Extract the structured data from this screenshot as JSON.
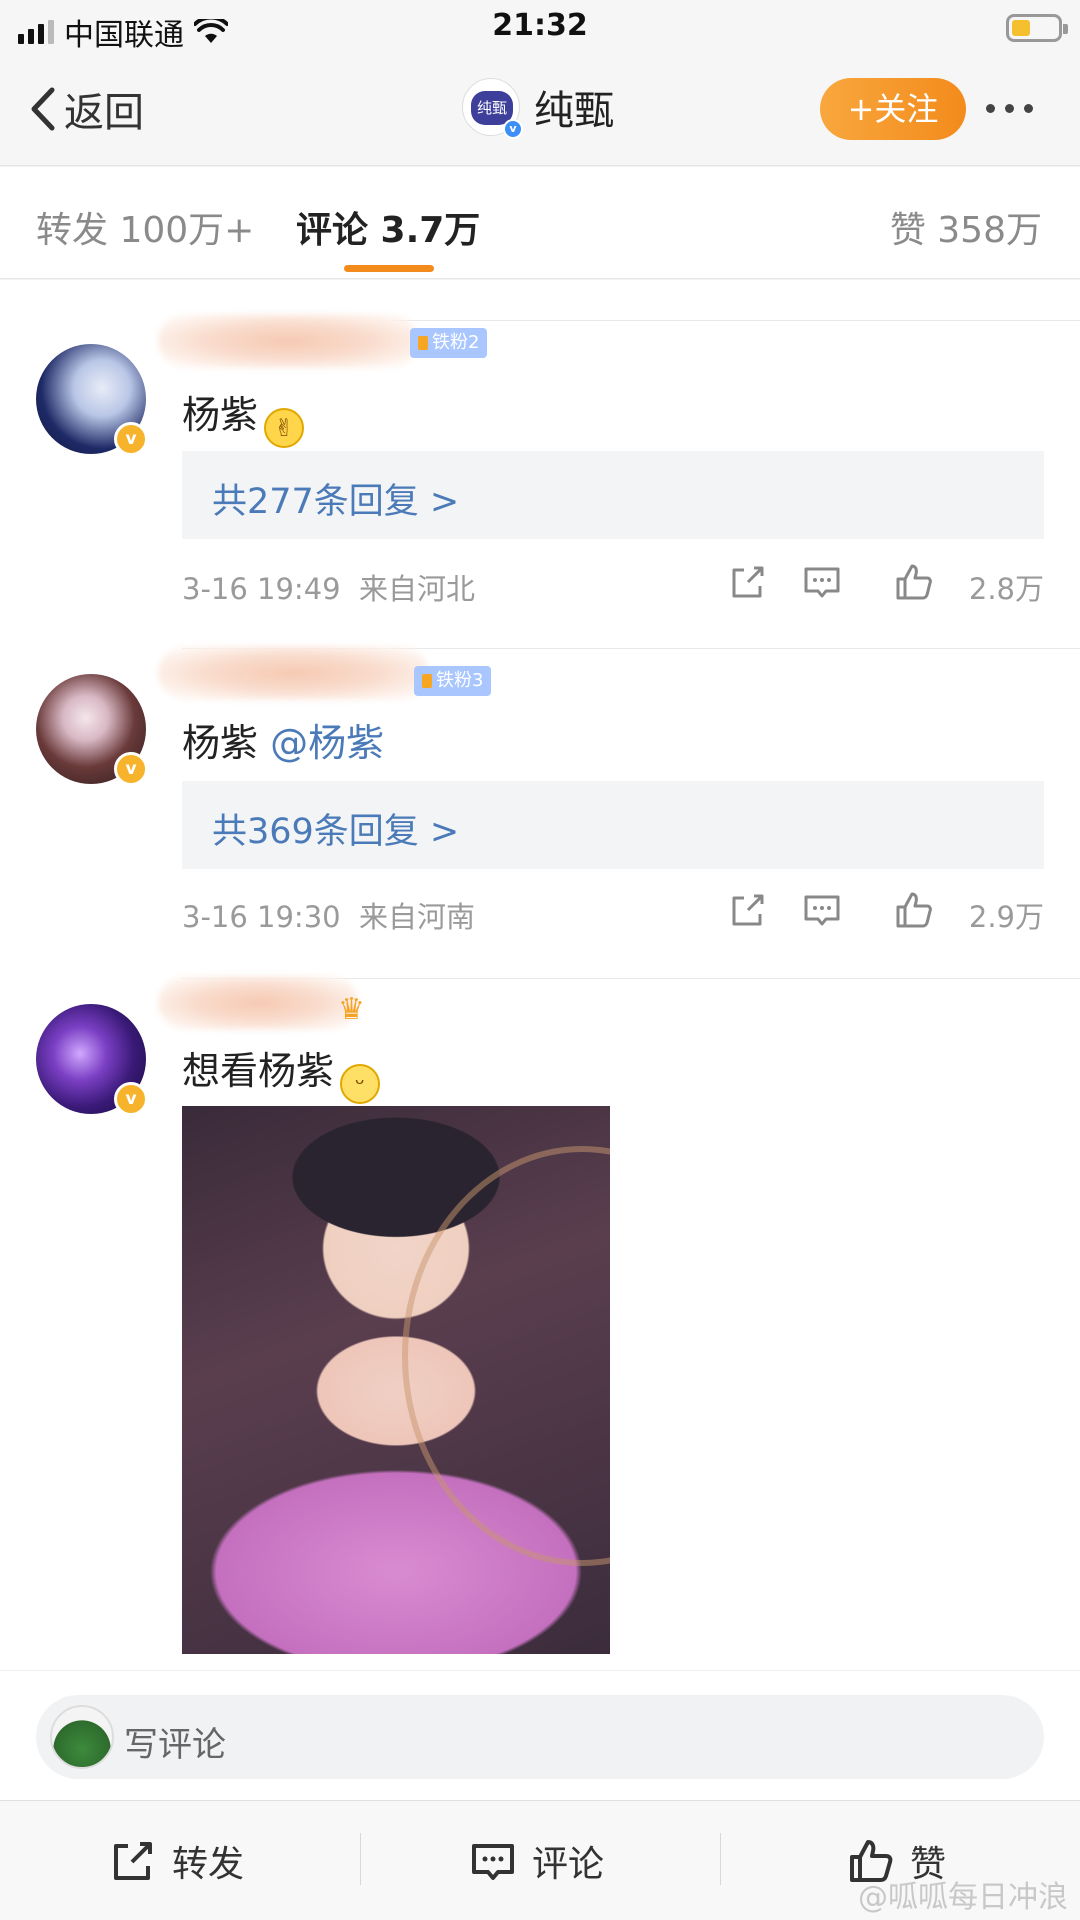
{
  "status": {
    "carrier": "中国联通",
    "time": "21:32"
  },
  "nav": {
    "back_label": "返回",
    "logo_text": "纯甄",
    "title": "纯甄",
    "follow_label": "+关注"
  },
  "tabs": {
    "repost": "转发 100万+",
    "comments": "评论 3.7万",
    "likes": "赞 358万"
  },
  "comments": [
    {
      "fan_badge": "铁粉2",
      "text": "杨紫",
      "emoji": "peace-hand-emoji",
      "replies": "共277条回复 >",
      "time": "3-16 19:49",
      "source": "来自河北",
      "likes": "2.8万"
    },
    {
      "fan_badge": "铁粉3",
      "text": "杨紫",
      "mention": "@杨紫",
      "replies": "共369条回复 >",
      "time": "3-16 19:30",
      "source": "来自河南",
      "likes": "2.9万"
    },
    {
      "badge_icon": "crown-icon",
      "text": "想看杨紫",
      "emoji": "grin-emoji"
    }
  ],
  "composer": {
    "placeholder": "写评论"
  },
  "actions": {
    "repost": "转发",
    "comment": "评论",
    "like": "赞"
  },
  "watermark": "@呱呱每日冲浪",
  "colors": {
    "accent": "#f38b1c",
    "link": "#4b7ab8",
    "verified_gold": "#f7b32b"
  }
}
